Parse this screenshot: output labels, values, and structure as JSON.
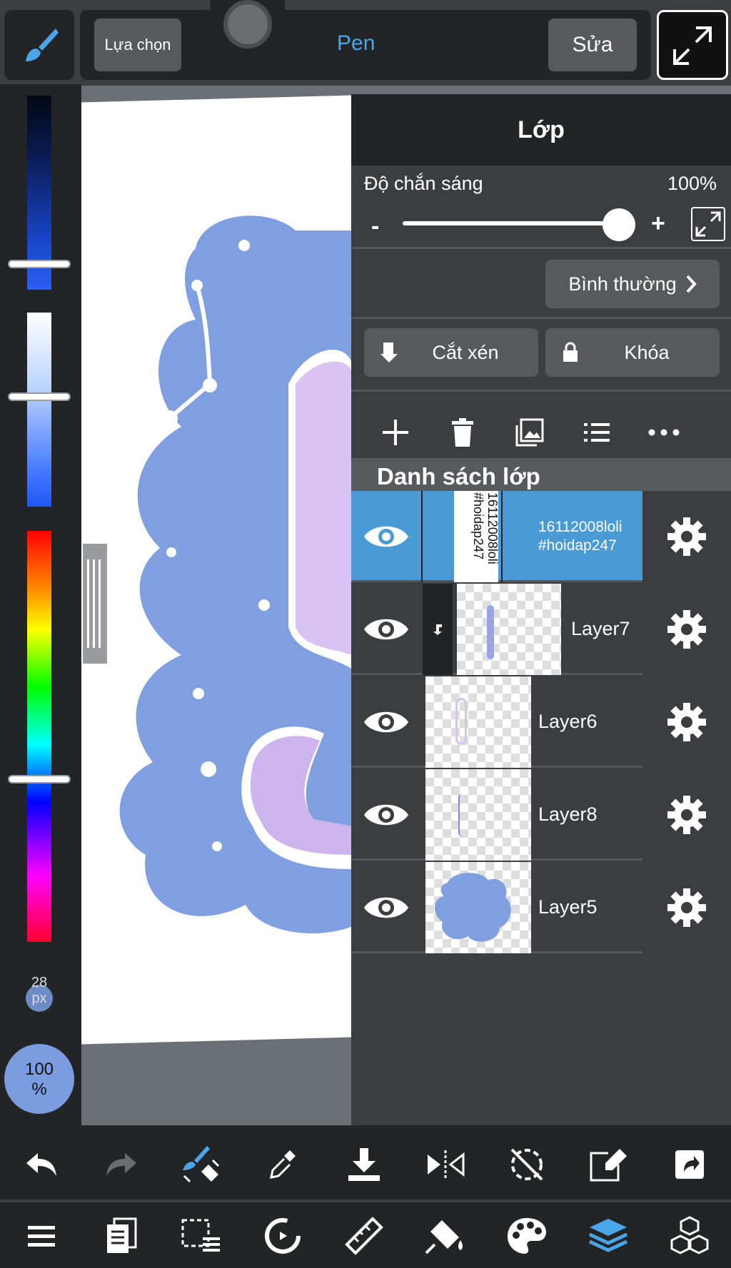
{
  "top_bar": {
    "selection_label": "Lựa chọn",
    "tool_name": "Pen",
    "edit_label": "Sửa"
  },
  "left_panel": {
    "brush_size": "28\npx",
    "brush_opacity": "100\n%"
  },
  "layer_panel": {
    "title": "Lớp",
    "opacity_label": "Độ chắn sáng",
    "opacity_value": "100%",
    "opacity_level": 1.0,
    "minus": "-",
    "plus": "+",
    "blend_mode": "Bình thường",
    "clipping_label": "Cắt xén",
    "lock_label": "Khóa",
    "list_header": "Danh sách lớp",
    "layers": [
      {
        "name": "16112008loli\n#hoidap247",
        "thumb_text": "16112008loli\n#hoidap247",
        "selected": true,
        "clipped": false
      },
      {
        "name": "Layer7",
        "selected": false,
        "clipped": true
      },
      {
        "name": "Layer6",
        "selected": false,
        "clipped": false
      },
      {
        "name": "Layer8",
        "selected": false,
        "clipped": false
      },
      {
        "name": "Layer5",
        "selected": false,
        "clipped": false
      }
    ]
  },
  "colors": {
    "accent": "#4a9ad6",
    "panel": "#3c3d40",
    "dark": "#232426",
    "canvas_art": "#7f9fe0"
  },
  "icons": {
    "top": [
      "brush-icon",
      "expand-icon"
    ],
    "layer_actions": [
      "add-icon",
      "trash-icon",
      "image-icon",
      "list-icon",
      "more-icon"
    ],
    "bottom_row1": [
      "undo-icon",
      "redo-icon",
      "brush-transform-icon",
      "eyedropper-icon",
      "download-icon",
      "flip-icon",
      "rotate-reset-icon",
      "edit-icon",
      "share-icon"
    ],
    "bottom_row2": [
      "menu-icon",
      "pages-icon",
      "selection-icon",
      "rotate-icon",
      "ruler-icon",
      "fill-icon",
      "palette-icon",
      "layers-icon",
      "materials-icon"
    ]
  }
}
